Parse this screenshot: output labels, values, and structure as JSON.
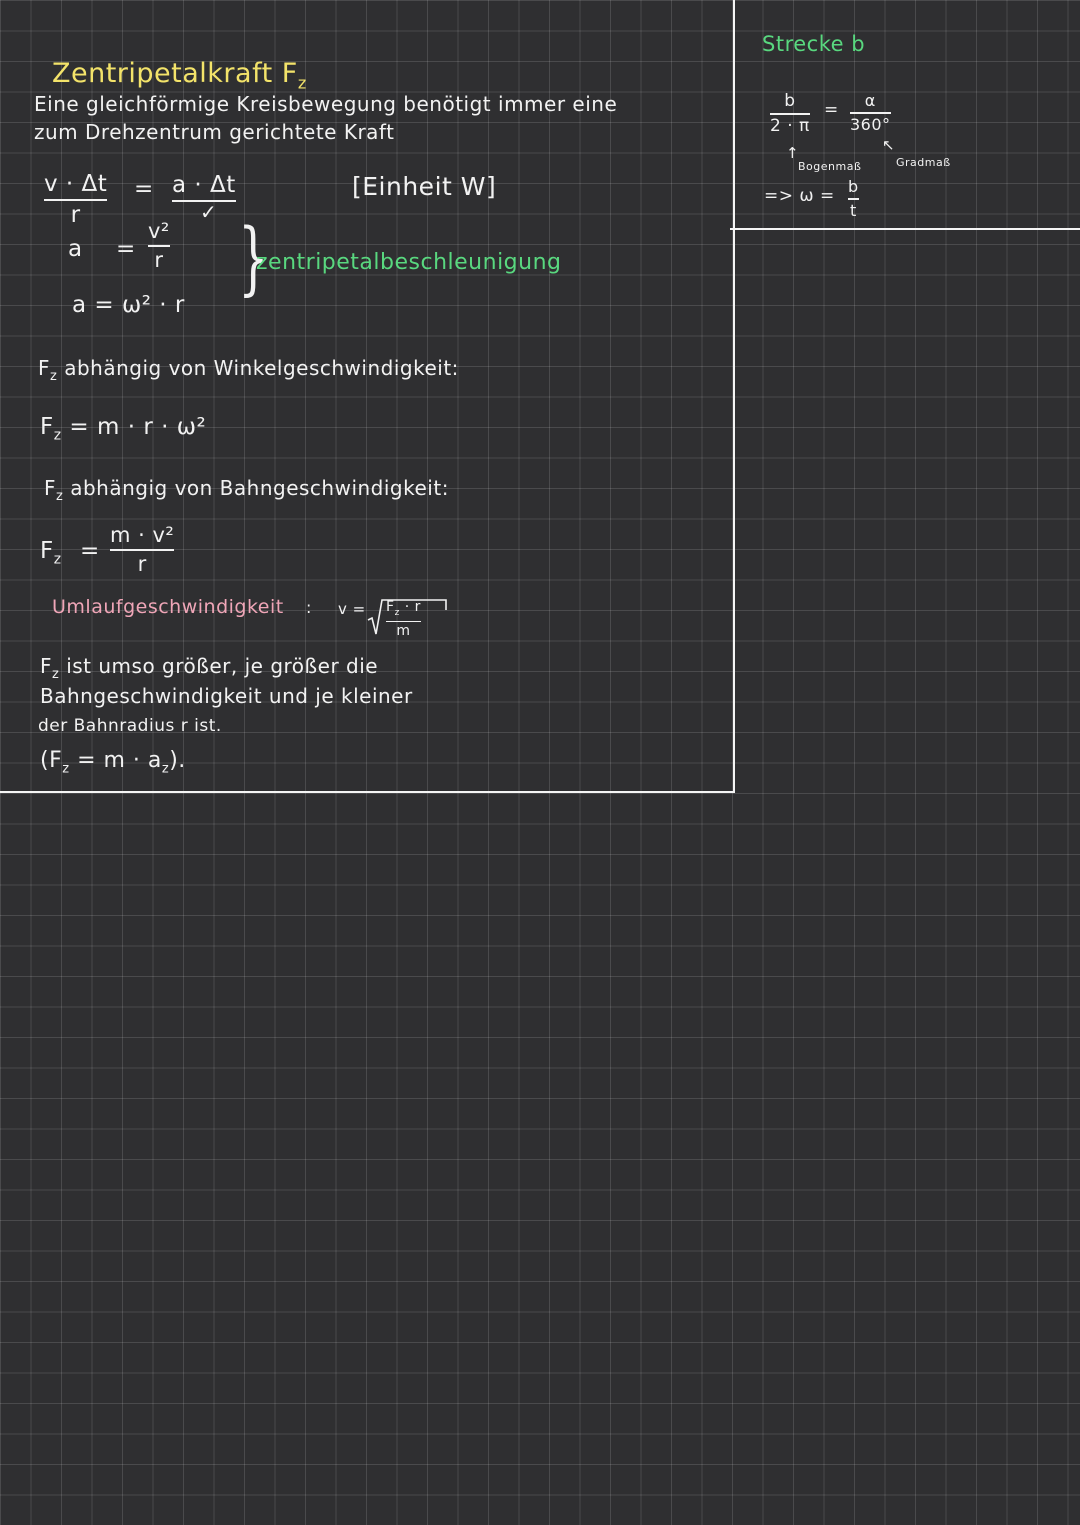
{
  "main": {
    "title": "Zentripetalkraft F",
    "title_sub": "z",
    "intro_line1": "Eine gleichförmige Kreisbewegung benötigt immer eine",
    "intro_line2": "zum Drehzentrum gerichtete Kraft",
    "eq1_left_num": "v · Δt",
    "eq1_left_den": "r",
    "eq1_eq": "=",
    "eq1_right": "a · Δt",
    "check": "✓",
    "unit_note": "[Einheit W]",
    "acc1_left": "a",
    "acc1_eq": "=",
    "acc1_num": "v²",
    "acc1_den": "r",
    "acc2": "a = ω² · r",
    "acc_label": "zentripetalbeschleunigung",
    "dep1_text": "F",
    "dep1_sub": "z",
    "dep1_rest": " abhängig von Winkelgeschwindigkeit:",
    "formula1": "F",
    "formula1_sub": "z",
    "formula1_rest": " = m · r · ω²",
    "dep2_text": "F",
    "dep2_sub": "z",
    "dep2_rest": " abhängig von Bahngeschwindigkeit:",
    "formula2_left": "F",
    "formula2_sub": "z",
    "formula2_eq": "=",
    "formula2_num": "m · v²",
    "formula2_den": "r",
    "orbit_label": "Umlaufgeschwindigkeit",
    "orbit_colon": ":",
    "orbit_v": "v =",
    "orbit_num": "F",
    "orbit_num_sub": "z",
    "orbit_num_rest": " · r",
    "orbit_den": "m",
    "concl_line1": "ist umso größer, je größer die",
    "concl_line2": "Bahngeschwindigkeit und je kleiner",
    "concl_line3": "der Bahnradius r ist.",
    "concl_prefix": "F",
    "concl_prefix_sub": "z",
    "final_formula": "(F",
    "final_formula_sub": "z",
    "final_formula_rest": " = m · a",
    "final_formula_sub2": "z",
    "final_formula_end": ")."
  },
  "side": {
    "title": "Strecke b",
    "frac1_num": "b",
    "frac1_den": "2 · π",
    "eq": "=",
    "frac2_num": "α",
    "frac2_den": "360°",
    "label_bogen": "Bogenmaß",
    "label_grad": "Gradmaß",
    "arrow_up": "↑",
    "arrow_diag": "↖",
    "omega_prefix": "=> ω =",
    "omega_num": "b",
    "omega_den": "t"
  },
  "colors": {
    "background": "#2f2f31",
    "grid": "#4a4a4c",
    "title_yellow": "#f3e36a",
    "accent_green": "#59d87f",
    "label_pink": "#f0a6b8",
    "ink": "#f2f2f2"
  }
}
